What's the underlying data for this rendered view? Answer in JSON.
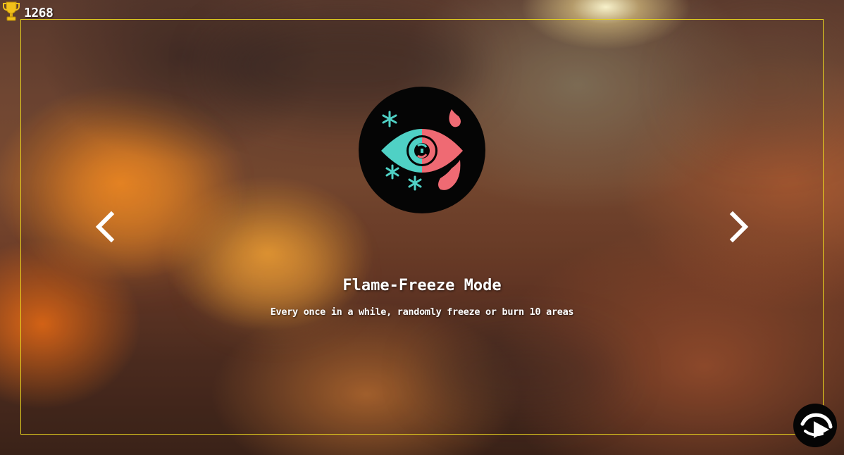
{
  "hud": {
    "score": "1268",
    "score_icon": "trophy-icon"
  },
  "mode": {
    "title": "Flame-Freeze Mode",
    "description": "Every once in a while, randomly freeze or burn 10 areas",
    "icon": "flame-freeze-eye-icon"
  },
  "navigation": {
    "prev_icon": "chevron-left-icon",
    "next_icon": "chevron-right-icon"
  },
  "actions": {
    "start_icon": "play-arrow-icon"
  },
  "colors": {
    "panel_border": "#e6d21e",
    "icon_ice": "#4fd1c5",
    "icon_fire": "#ef6a73",
    "icon_bg": "#050505"
  }
}
